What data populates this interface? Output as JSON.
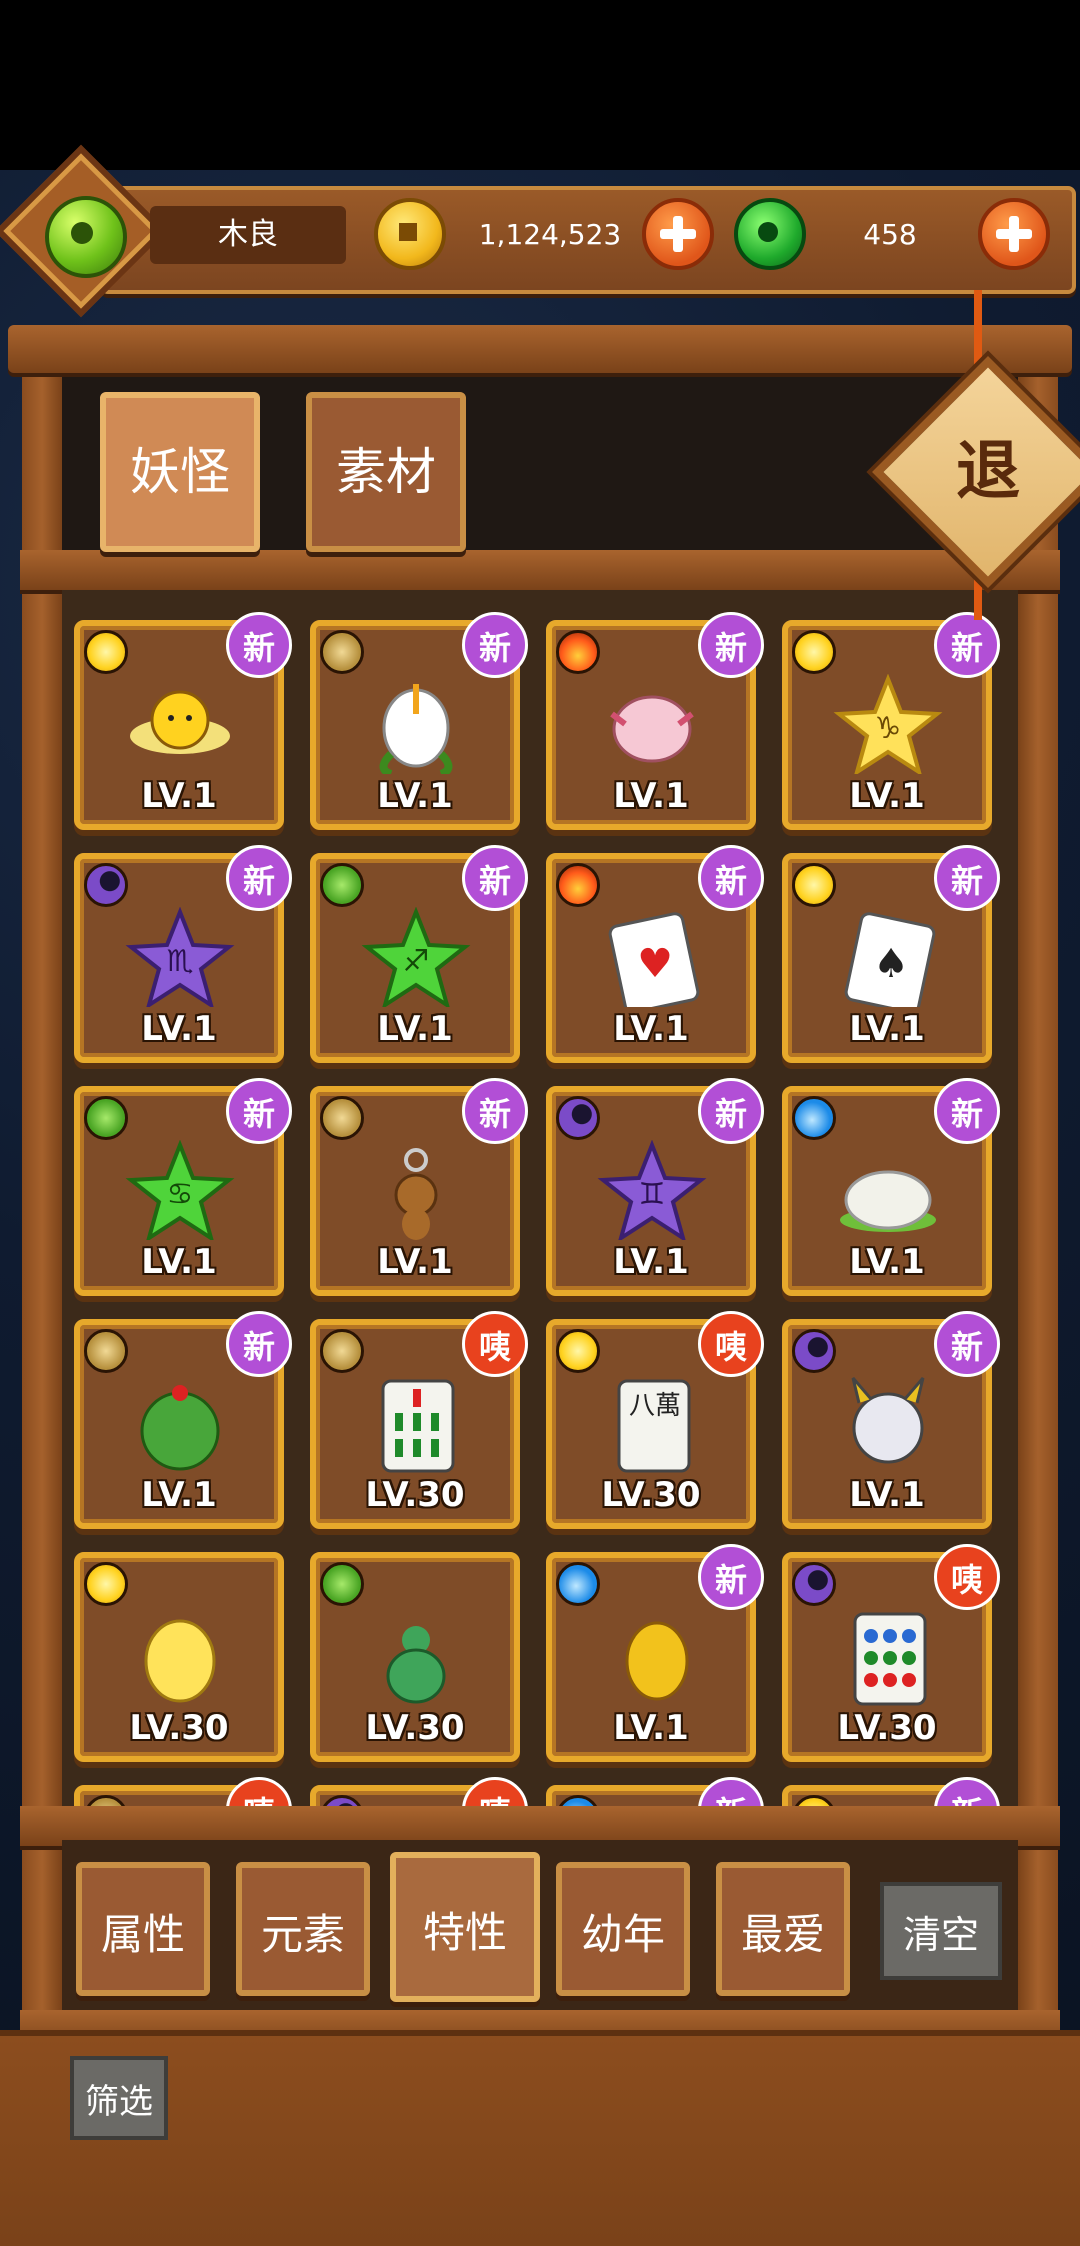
{
  "player": {
    "name": "木良"
  },
  "currency": {
    "gold": "1,124,523",
    "jade": "458"
  },
  "colors": {
    "accent_gold": "#e7a92b",
    "badge_new": "#b24fd6",
    "badge_alert": "#e8421e",
    "wood": "#7f4c28"
  },
  "tabs": [
    {
      "label": "妖怪",
      "active": true
    },
    {
      "label": "素材",
      "active": false
    }
  ],
  "exit_label": "退",
  "items": [
    {
      "element": "sun",
      "art": "flower-chick",
      "level": "LV.1",
      "badge": "新"
    },
    {
      "element": "earth",
      "art": "lily-bud",
      "level": "LV.1",
      "badge": "新"
    },
    {
      "element": "fire",
      "art": "pink-axolotl",
      "level": "LV.1",
      "badge": "新"
    },
    {
      "element": "sun",
      "art": "yellow-star-capricorn",
      "level": "LV.1",
      "badge": "新"
    },
    {
      "element": "moon",
      "art": "purple-star-scorpio",
      "level": "LV.1",
      "badge": "新"
    },
    {
      "element": "leaf",
      "art": "green-star-sagittarius",
      "level": "LV.1",
      "badge": "新"
    },
    {
      "element": "fire",
      "art": "queen-of-hearts-card",
      "level": "LV.1",
      "badge": "新"
    },
    {
      "element": "sun",
      "art": "jack-of-spades-card",
      "level": "LV.1",
      "badge": "新"
    },
    {
      "element": "leaf",
      "art": "green-star-cancer",
      "level": "LV.1",
      "badge": "新"
    },
    {
      "element": "earth",
      "art": "monkey-charm",
      "level": "LV.1",
      "badge": "新"
    },
    {
      "element": "moon",
      "art": "purple-star-gemini",
      "level": "LV.1",
      "badge": "新"
    },
    {
      "element": "water",
      "art": "white-dragon-bun",
      "level": "LV.1",
      "badge": "新"
    },
    {
      "element": "earth",
      "art": "cactus-melon",
      "level": "LV.1",
      "badge": "新"
    },
    {
      "element": "earth",
      "art": "mahjong-bamboo-tile",
      "level": "LV.30",
      "badge": "咦"
    },
    {
      "element": "sun",
      "art": "mahjong-character-tile",
      "level": "LV.30",
      "badge": "咦",
      "tile_text": "八萬"
    },
    {
      "element": "moon",
      "art": "oni-mask",
      "level": "LV.1",
      "badge": "新"
    },
    {
      "element": "sun",
      "art": "glowing-ghost",
      "level": "LV.30",
      "badge": ""
    },
    {
      "element": "leaf",
      "art": "jade-gourd",
      "level": "LV.30",
      "badge": ""
    },
    {
      "element": "water",
      "art": "gold-ingot",
      "level": "LV.1",
      "badge": "新"
    },
    {
      "element": "moon",
      "art": "mahjong-circle-tile",
      "level": "LV.30",
      "badge": "咦"
    },
    {
      "element": "earth",
      "art": "",
      "level": "",
      "badge": "咦"
    },
    {
      "element": "moon",
      "art": "",
      "level": "",
      "badge": "咦"
    },
    {
      "element": "water",
      "art": "",
      "level": "",
      "badge": "新"
    },
    {
      "element": "sun",
      "art": "",
      "level": "",
      "badge": "新"
    }
  ],
  "filters": [
    {
      "label": "属性",
      "active": false
    },
    {
      "label": "元素",
      "active": false
    },
    {
      "label": "特性",
      "active": true
    },
    {
      "label": "幼年",
      "active": false
    },
    {
      "label": "最爱",
      "active": false
    }
  ],
  "clear_label": "清空",
  "filter_label": "筛选"
}
